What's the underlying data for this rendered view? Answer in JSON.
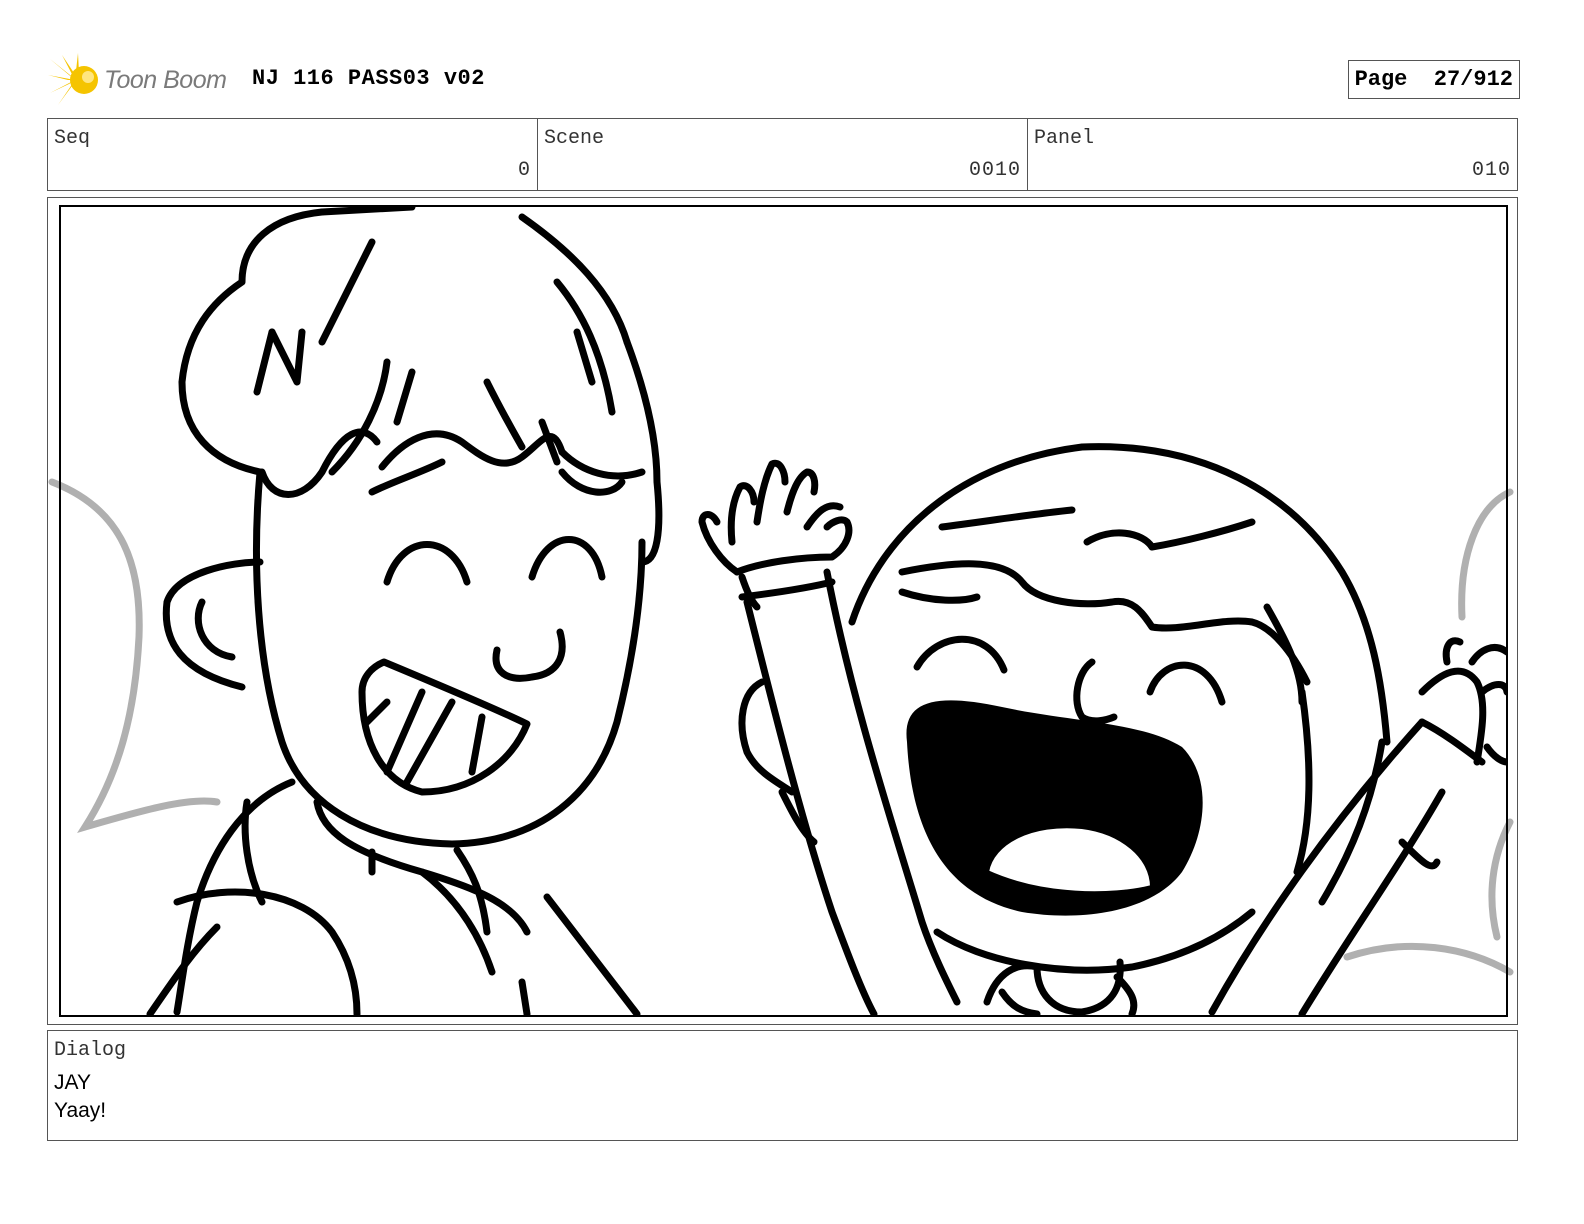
{
  "header": {
    "logo_text": "Toon Boom",
    "title": "NJ 116 PASS03 v02",
    "page_label": "Page",
    "page_value": "27/912"
  },
  "meta": {
    "seq_label": "Seq",
    "seq_value": "0",
    "scene_label": "Scene",
    "scene_value": "0010",
    "panel_label": "Panel",
    "panel_value": "010"
  },
  "dialog": {
    "label": "Dialog",
    "lines": [
      "JAY",
      "Yaay!"
    ]
  },
  "colors": {
    "logo_star": "#f5c400",
    "logo_text": "#7a7a7a",
    "border": "#555555",
    "ink": "#000000",
    "background_sketch": "#b0b0b0"
  },
  "icons": {
    "logo": "starburst-logo-icon"
  }
}
